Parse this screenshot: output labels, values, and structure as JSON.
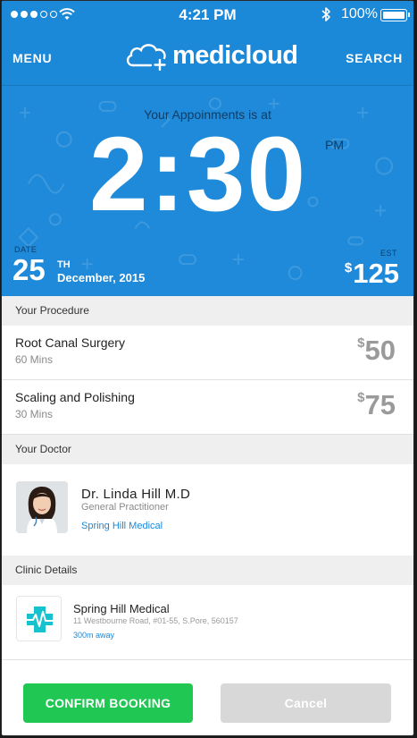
{
  "status_bar": {
    "time": "4:21 PM",
    "battery": "100%",
    "signal_dots_filled": 3,
    "signal_dots_total": 5
  },
  "nav": {
    "menu_label": "MENU",
    "search_label": "SEARCH",
    "logo_text": "medicloud"
  },
  "appointment": {
    "caption": "Your Appoinments is at",
    "time": "2:30",
    "ampm": "PM",
    "date_label": "DATE",
    "day": "25",
    "day_suffix": "TH",
    "month_year": "December, 2015",
    "est_label": "EST",
    "currency": "$",
    "est_amount": "125"
  },
  "procedure": {
    "heading": "Your Procedure",
    "items": [
      {
        "name": "Root Canal Surgery",
        "duration": "60 Mins",
        "currency": "$",
        "price": "50"
      },
      {
        "name": "Scaling and Polishing",
        "duration": "30 Mins",
        "currency": "$",
        "price": "75"
      }
    ]
  },
  "doctor": {
    "heading": "Your Doctor",
    "name": "Dr. Linda Hill  M.D",
    "role": "General Practitioner",
    "clinic": "Spring Hill Medical"
  },
  "clinic": {
    "heading": "Clinic Details",
    "name": "Spring Hill Medical",
    "address": "11 Westbourne Road, #01-55, S.Pore, 560157",
    "distance": "300m away"
  },
  "actions": {
    "confirm_label": "CONFIRM BOOKING",
    "cancel_label": "Cancel"
  },
  "colors": {
    "brand_blue": "#1c88d8",
    "confirm_green": "#20c853",
    "cancel_gray": "#d8d8d8"
  }
}
